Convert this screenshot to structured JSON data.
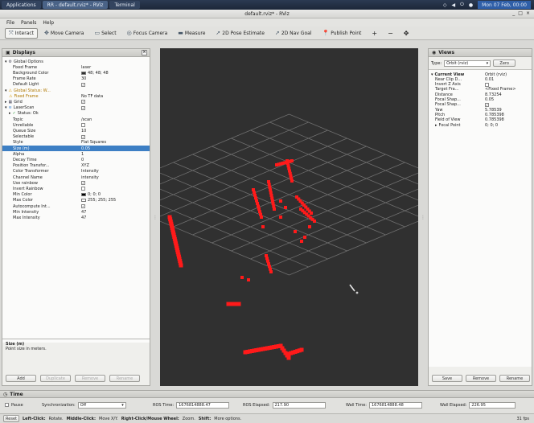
{
  "taskbar": {
    "tasks": [
      {
        "label": "Applications",
        "state": "inactive"
      },
      {
        "label": "RR - default.rviz* - RViz",
        "state": "active"
      },
      {
        "label": "Terminal",
        "state": "inactive"
      }
    ],
    "clock": "Mon 07 Feb, 00:00"
  },
  "window": {
    "title": "default.rviz* - RViz",
    "controls": [
      "_",
      "□",
      "×"
    ]
  },
  "menu": [
    "File",
    "Panels",
    "Help"
  ],
  "toolbar": {
    "tools": [
      {
        "label": "Interact",
        "glyph": "⤧",
        "active": true
      },
      {
        "label": "Move Camera",
        "glyph": "✥",
        "active": false
      },
      {
        "label": "Select",
        "glyph": "▭",
        "active": false
      },
      {
        "label": "Focus Camera",
        "glyph": "◎",
        "active": false
      },
      {
        "label": "Measure",
        "glyph": "▬",
        "active": false
      },
      {
        "label": "2D Pose Estimate",
        "glyph": "➚",
        "active": false
      },
      {
        "label": "2D Nav Goal",
        "glyph": "➚",
        "active": false
      },
      {
        "label": "Publish Point",
        "glyph": "📍",
        "active": false
      }
    ],
    "extra": [
      "+",
      "−",
      "✥"
    ]
  },
  "displays": {
    "title": "Displays",
    "rows": [
      {
        "indent": 0,
        "arrow": "▾",
        "icon": "gear",
        "label": "Global Options",
        "value": ""
      },
      {
        "indent": 2,
        "label": "Fixed Frame",
        "value": "laser"
      },
      {
        "indent": 2,
        "label": "Background Color",
        "value": "48; 48; 48",
        "swatch": "#303030"
      },
      {
        "indent": 2,
        "label": "Frame Rate",
        "value": "30"
      },
      {
        "indent": 2,
        "label": "Default Light",
        "value": "✓",
        "check": true
      },
      {
        "indent": 0,
        "arrow": "▾",
        "icon": "warn",
        "label": "Global Status: W...",
        "value": "",
        "warn": true
      },
      {
        "indent": 1,
        "icon": "warn",
        "label": "Fixed Frame",
        "value": "No TF data",
        "warn": true
      },
      {
        "indent": 0,
        "arrow": "▸",
        "icon": "grid",
        "label": "Grid",
        "value": "✓",
        "check": true
      },
      {
        "indent": 0,
        "arrow": "▾",
        "icon": "scan",
        "label": "LaserScan",
        "value": "✓",
        "check": true
      },
      {
        "indent": 1,
        "arrow": "▸",
        "icon": "ok",
        "label": "Status: Ok",
        "value": ""
      },
      {
        "indent": 2,
        "label": "Topic",
        "value": "/scan"
      },
      {
        "indent": 2,
        "label": "Unreliable",
        "value": "",
        "check": true
      },
      {
        "indent": 2,
        "label": "Queue Size",
        "value": "10"
      },
      {
        "indent": 2,
        "label": "Selectable",
        "value": "✓",
        "check": true
      },
      {
        "indent": 2,
        "label": "Style",
        "value": "Flat Squares"
      },
      {
        "indent": 2,
        "label": "Size (m)",
        "value": "0.05",
        "selected": true
      },
      {
        "indent": 2,
        "label": "Alpha",
        "value": "1"
      },
      {
        "indent": 2,
        "label": "Decay Time",
        "value": "0"
      },
      {
        "indent": 2,
        "label": "Position Transfor...",
        "value": "XYZ"
      },
      {
        "indent": 2,
        "label": "Color Transformer",
        "value": "Intensity"
      },
      {
        "indent": 2,
        "label": "Channel Name",
        "value": "intensity"
      },
      {
        "indent": 2,
        "label": "Use rainbow",
        "value": "✓",
        "check": true
      },
      {
        "indent": 2,
        "label": "Invert Rainbow",
        "value": "",
        "check": true
      },
      {
        "indent": 2,
        "label": "Min Color",
        "value": "0; 0; 0",
        "swatch": "#000000"
      },
      {
        "indent": 2,
        "label": "Max Color",
        "value": "255; 255; 255",
        "swatch": "#ffffff"
      },
      {
        "indent": 2,
        "label": "Autocompute Int...",
        "value": "✓",
        "check": true
      },
      {
        "indent": 2,
        "label": "Min Intensity",
        "value": "47"
      },
      {
        "indent": 2,
        "label": "Max Intensity",
        "value": "47"
      }
    ],
    "description_title": "Size (m)",
    "description_text": "Point size in meters.",
    "buttons": [
      "Add",
      "Duplicate",
      "Remove",
      "Rename"
    ]
  },
  "views": {
    "title": "Views",
    "type_label": "Type:",
    "type_value": "Orbit (rviz)",
    "zero_label": "Zero",
    "rows": [
      {
        "indent": 0,
        "arrow": "▾",
        "label": "Current View",
        "value": "Orbit (rviz)",
        "bold": true
      },
      {
        "indent": 1,
        "label": "Near Clip D...",
        "value": "0.01"
      },
      {
        "indent": 1,
        "label": "Invert Z Axis",
        "value": "",
        "check": true
      },
      {
        "indent": 1,
        "label": "Target Fra...",
        "value": "<Fixed Frame>"
      },
      {
        "indent": 1,
        "label": "Distance",
        "value": "8.73254"
      },
      {
        "indent": 1,
        "label": "Focal Shap...",
        "value": "0.05"
      },
      {
        "indent": 1,
        "label": "Focal Shap...",
        "value": "✓",
        "check": true
      },
      {
        "indent": 1,
        "label": "Yaw",
        "value": "5.78539"
      },
      {
        "indent": 1,
        "label": "Pitch",
        "value": "0.785398"
      },
      {
        "indent": 1,
        "label": "Field of View",
        "value": "0.785398"
      },
      {
        "indent": 1,
        "arrow": "▸",
        "label": "Focal Point",
        "value": "0; 0; 0"
      }
    ],
    "buttons": [
      "Save",
      "Remove",
      "Rename"
    ]
  },
  "time": {
    "title": "Time",
    "pause_label": "Pause",
    "sync_label": "Synchronization:",
    "sync_value": "Off",
    "ros_time_label": "ROS Time:",
    "ros_time_value": "1676814888.47",
    "ros_elapsed_label": "ROS Elapsed:",
    "ros_elapsed_value": "217.90",
    "wall_time_label": "Wall Time:",
    "wall_time_value": "1676814888.48",
    "wall_elapsed_label": "Wall Elapsed:",
    "wall_elapsed_value": "226.95"
  },
  "status": {
    "reset": "Reset",
    "left_key": "Left-Click:",
    "left_val": "Rotate.",
    "mid_key": "Middle-Click:",
    "mid_val": "Move X/Y.",
    "right_key": "Right-Click/Mouse Wheel:",
    "right_val": "Zoom.",
    "shift_key": "Shift:",
    "shift_val": "More options.",
    "fps": "31 fps"
  },
  "colors": {
    "scan_points": "#ff1a1a",
    "grid_lines": "#6f6f6f",
    "viewport_bg": "#303030",
    "selection": "#3d7fc4"
  }
}
